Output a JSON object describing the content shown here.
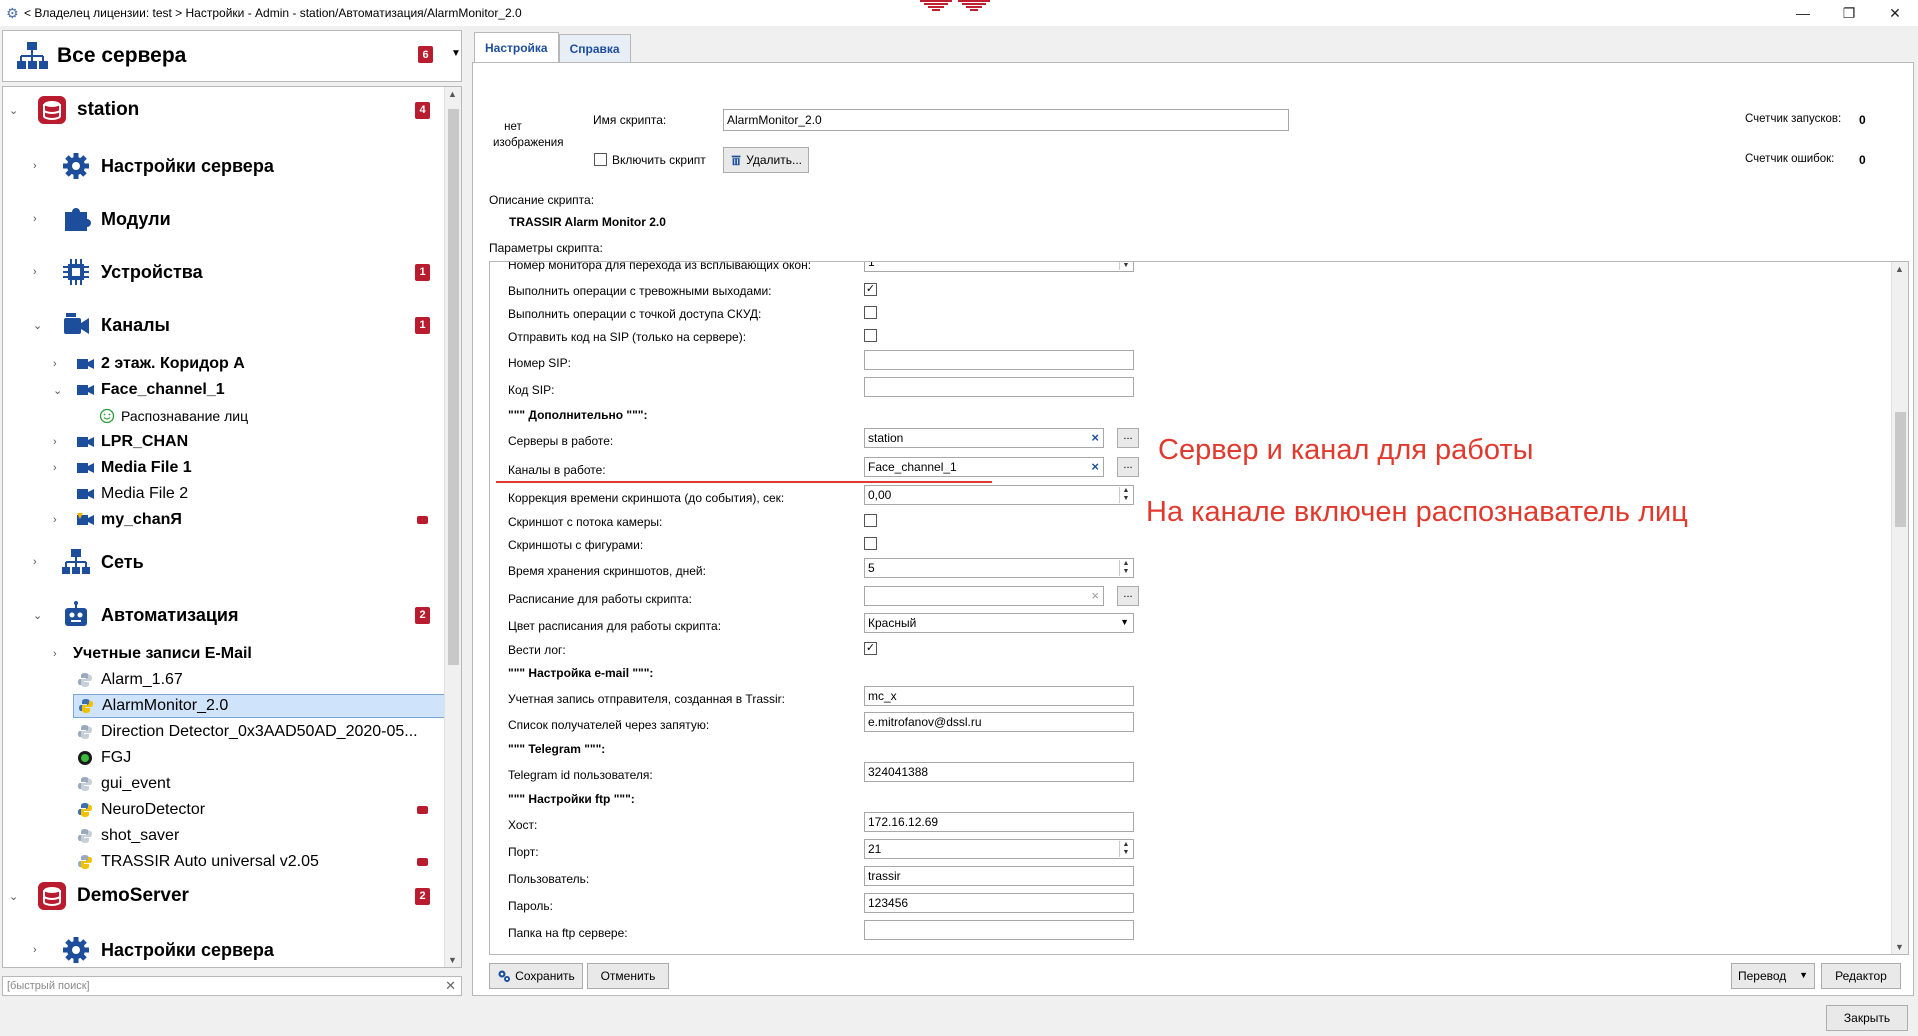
{
  "window": {
    "title": "< Владелец лицензии: test > Настройки - Admin - station/Автоматизация/AlarmMonitor_2.0",
    "controls": [
      "—",
      "❐",
      "✕"
    ]
  },
  "sidebar": {
    "header": {
      "label": "Все сервера",
      "badge": "6"
    },
    "tree": [
      {
        "label": "station",
        "badge": "4"
      },
      {
        "label": "Настройки сервера"
      },
      {
        "label": "Модули"
      },
      {
        "label": "Устройства",
        "badge": "1"
      },
      {
        "label": "Каналы",
        "badge": "1"
      },
      {
        "label": "2 этаж. Коридор А"
      },
      {
        "label": "Face_channel_1"
      },
      {
        "label": "Распознавание лиц"
      },
      {
        "label": "LPR_CHAN"
      },
      {
        "label": "Media File 1"
      },
      {
        "label": "Media File 2"
      },
      {
        "label": "my_chanЯ"
      },
      {
        "label": "Сеть"
      },
      {
        "label": "Автоматизация",
        "badge": "2"
      },
      {
        "label": "Учетные записи E-Mail"
      },
      {
        "label": "Alarm_1.67"
      },
      {
        "label": "AlarmMonitor_2.0"
      },
      {
        "label": "Direction Detector_0x3AAD50AD_2020-05..."
      },
      {
        "label": "FGJ"
      },
      {
        "label": "gui_event"
      },
      {
        "label": "NeuroDetector"
      },
      {
        "label": "shot_saver"
      },
      {
        "label": "TRASSIR Auto universal v2.05"
      },
      {
        "label": "DemoServer",
        "badge": "2"
      },
      {
        "label": "Настройки сервера"
      }
    ],
    "quick_search_placeholder": "[быстрый поиск]"
  },
  "tabs": [
    {
      "label": "Настройка"
    },
    {
      "label": "Справка"
    }
  ],
  "script": {
    "no_image": "нет изображения",
    "name_label": "Имя скрипта:",
    "name_value": "AlarmMonitor_2.0",
    "enable_label": "Включить скрипт",
    "delete_label": "Удалить...",
    "run_counter_label": "Счетчик запусков:",
    "run_counter_value": "0",
    "error_counter_label": "Счетчик ошибок:",
    "error_counter_value": "0",
    "description_label": "Описание скрипта:",
    "description_value": "TRASSIR Alarm Monitor 2.0",
    "params_label": "Параметры скрипта:"
  },
  "params": [
    {
      "label": "Номер монитора для перехода из всплывающих окон:",
      "type": "spin",
      "value": "1"
    },
    {
      "label": "Выполнить операции с тревожными выходами:",
      "type": "check",
      "checked": true
    },
    {
      "label": "Выполнить операции с точкой доступа СКУД:",
      "type": "check",
      "checked": false
    },
    {
      "label": "Отправить код на SIP (только на сервере):",
      "type": "check",
      "checked": false
    },
    {
      "label": "Номер SIP:",
      "type": "text",
      "value": ""
    },
    {
      "label": "Код SIP:",
      "type": "text",
      "value": ""
    },
    {
      "label": "\"\"\" Дополнительно \"\"\":",
      "type": "header"
    },
    {
      "label": "Серверы в работе:",
      "type": "list",
      "value": "station",
      "clear": "×",
      "more": "..."
    },
    {
      "label": "Каналы в работе:",
      "type": "list",
      "value": "Face_channel_1",
      "clear": "×",
      "more": "..."
    },
    {
      "label": "Коррекция времени скриншота (до события), сек:",
      "type": "spin",
      "value": "0,00"
    },
    {
      "label": "Скриншот с потока камеры:",
      "type": "check",
      "checked": false
    },
    {
      "label": "Скриншоты с фигурами:",
      "type": "check",
      "checked": false
    },
    {
      "label": "Время хранения скриншотов, дней:",
      "type": "spin",
      "value": "5"
    },
    {
      "label": "Расписание для работы скрипта:",
      "type": "list-grey",
      "value": "",
      "clear": "×",
      "more": "..."
    },
    {
      "label": "Цвет расписания для работы скрипта:",
      "type": "select",
      "value": "Красный"
    },
    {
      "label": "Вести лог:",
      "type": "check",
      "checked": true
    },
    {
      "label": "\"\"\" Настройка e-mail \"\"\":",
      "type": "header"
    },
    {
      "label": "Учетная запись отправителя, созданная в Trassir:",
      "type": "text",
      "value": "mc_x"
    },
    {
      "label": "Список получателей через запятую:",
      "type": "text",
      "value": "e.mitrofanov@dssl.ru"
    },
    {
      "label": "\"\"\" Telegram \"\"\":",
      "type": "header"
    },
    {
      "label": "Telegram id пользователя:",
      "type": "text",
      "value": "324041388"
    },
    {
      "label": "\"\"\" Настройки ftp \"\"\":",
      "type": "header"
    },
    {
      "label": "Хост:",
      "type": "text",
      "value": "172.16.12.69"
    },
    {
      "label": "Порт:",
      "type": "spin",
      "value": "21"
    },
    {
      "label": "Пользователь:",
      "type": "text",
      "value": "trassir"
    },
    {
      "label": "Пароль:",
      "type": "text",
      "value": "123456"
    },
    {
      "label": "Папка на ftp сервере:",
      "type": "text",
      "value": ""
    }
  ],
  "annotations": [
    "Сервер и канал для работы",
    "На канале включен распознаватель лиц"
  ],
  "footer": {
    "save": "Сохранить",
    "cancel": "Отменить",
    "translate": "Перевод",
    "editor": "Редактор",
    "close": "Закрыть"
  },
  "colors": {
    "accent": "#b81c2e",
    "annotation": "#e03a2e",
    "selection": "#cfe3fb",
    "link": "#1c4e9b"
  }
}
